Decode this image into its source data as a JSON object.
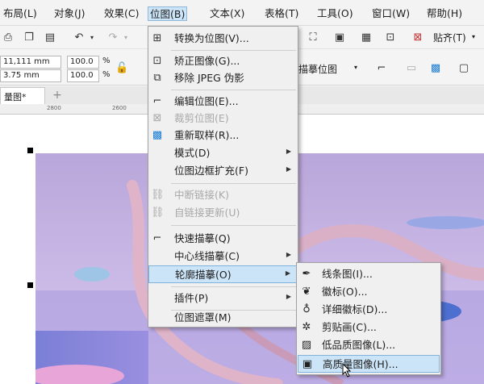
{
  "menubar": {
    "items": [
      {
        "label": "布局(L)"
      },
      {
        "label": "对象(J)"
      },
      {
        "label": "效果(C)"
      },
      {
        "label": "位图(B)"
      },
      {
        "label": "文本(X)"
      },
      {
        "label": "表格(T)"
      },
      {
        "label": "工具(O)"
      },
      {
        "label": "窗口(W)"
      },
      {
        "label": "帮助(H)"
      }
    ]
  },
  "toolbar": {
    "snap_label": "贴齐(T)",
    "width_value": "11,111 mm",
    "height_value": "3.75 mm",
    "scale_x": "100.0",
    "scale_y": "100.0",
    "percent_sign": "%",
    "trace_dropdown_label": "描摹位图"
  },
  "document_tab": {
    "label": "量图*",
    "add_symbol": "+"
  },
  "ruler": {
    "labels": [
      "2800",
      "2600"
    ]
  },
  "bitmap_menu": {
    "items": [
      {
        "label": "转换为位图(V)...",
        "icon": "convert-bitmap-icon"
      },
      {
        "label": "矫正图像(G)...",
        "icon": "straighten-icon"
      },
      {
        "label": "移除 JPEG 伪影",
        "icon": "jpeg-artifact-icon"
      },
      {
        "label": "编辑位图(E)...",
        "icon": "edit-bitmap-icon"
      },
      {
        "label": "裁剪位图(E)",
        "icon": "crop-bitmap-icon"
      },
      {
        "label": "重新取样(R)...",
        "icon": "resample-icon"
      },
      {
        "label": "模式(D)"
      },
      {
        "label": "位图边框扩充(F)"
      },
      {
        "label": "中断链接(K)",
        "icon": "break-link-icon"
      },
      {
        "label": "自链接更新(U)",
        "icon": "update-link-icon"
      },
      {
        "label": "快速描摹(Q)",
        "icon": "quick-trace-icon"
      },
      {
        "label": "中心线描摹(C)"
      },
      {
        "label": "轮廓描摹(O)"
      },
      {
        "label": "插件(P)"
      },
      {
        "label": "位图遮罩(M)"
      }
    ]
  },
  "outline_submenu": {
    "items": [
      {
        "label": "线条图(I)...",
        "icon": "line-art-icon"
      },
      {
        "label": "徽标(O)...",
        "icon": "logo-icon"
      },
      {
        "label": "详细徽标(D)...",
        "icon": "detailed-logo-icon"
      },
      {
        "label": "剪贴画(C)...",
        "icon": "clipart-icon"
      },
      {
        "label": "低品质图像(L)...",
        "icon": "low-quality-image-icon"
      },
      {
        "label": "高质量图像(H)...",
        "icon": "high-quality-image-icon"
      }
    ]
  },
  "colors": {
    "highlight": "#cce4f7",
    "highlight_border": "#7fb2dc",
    "menu_bg": "#f0f0f0",
    "disabled_text": "#a8a8a8"
  }
}
